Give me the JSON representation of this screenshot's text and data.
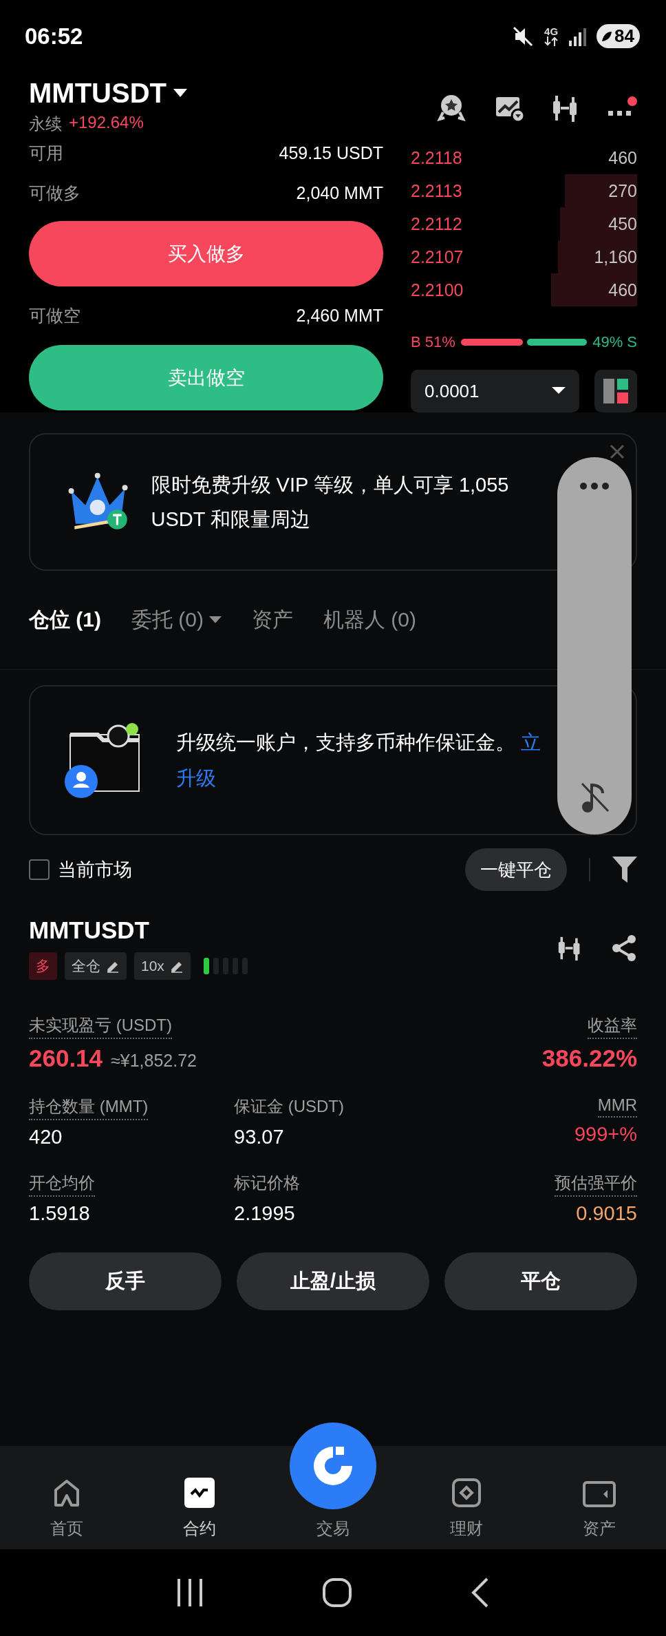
{
  "status_bar": {
    "time": "06:52",
    "network": "4G",
    "battery": "84"
  },
  "header": {
    "symbol": "MMTUSDT",
    "type": "永续",
    "change": "+192.64%",
    "notification": true
  },
  "order_panel": {
    "available_label": "可用",
    "available_value": "459.15 USDT",
    "long_label": "可做多",
    "long_value": "2,040 MMT",
    "buy_button": "买入做多",
    "short_label": "可做空",
    "short_value": "2,460 MMT",
    "sell_button": "卖出做空"
  },
  "order_book": {
    "asks": [
      {
        "price": "2.2118",
        "amount": "460"
      },
      {
        "price": "2.2113",
        "amount": "270"
      },
      {
        "price": "2.2112",
        "amount": "450"
      },
      {
        "price": "2.2107",
        "amount": "1,160"
      },
      {
        "price": "2.2100",
        "amount": "460"
      }
    ],
    "buy_label": "B 51%",
    "sell_label": "49% S",
    "precision": "0.0001"
  },
  "promo_banner": {
    "text": "限时免费升级 VIP 等级，单人可享 1,055 USDT 和限量周边"
  },
  "tabs": [
    {
      "label": "仓位 (1)",
      "selected": true,
      "dropdown": false
    },
    {
      "label": "委托 (0)",
      "selected": false,
      "dropdown": true
    },
    {
      "label": "资产",
      "selected": false,
      "dropdown": false
    },
    {
      "label": "机器人 (0)",
      "selected": false,
      "dropdown": false
    }
  ],
  "account_notice": {
    "text": "升级统一账户，支持多币种作保证金。",
    "link_line_1": "立",
    "link_line_2": "升级"
  },
  "filter": {
    "current_market": {
      "label": "当前市场",
      "checked": false
    },
    "close_all": "一键平仓"
  },
  "position": {
    "symbol": "MMTUSDT",
    "tags": [
      {
        "kind": "side",
        "label": "多"
      },
      {
        "kind": "editable",
        "label": "全仓"
      },
      {
        "kind": "editable",
        "label": "10x"
      }
    ],
    "risk": {
      "level": 0.2
    },
    "stats": [
      {
        "left": {
          "label": "未实现盈亏 (USDT)",
          "value": "260.14",
          "secondary": "≈¥1,852.72",
          "dotted": true,
          "color": "#f6475d"
        },
        "right": {
          "label": "收益率",
          "value": "386.22%",
          "dotted": true,
          "color": "#f6475d"
        }
      },
      {
        "left": {
          "label": "持仓数量 (MMT)",
          "value": "420",
          "dotted": true,
          "color": "#ffffff"
        },
        "middle": {
          "label": "保证金 (USDT)",
          "value": "93.07",
          "dotted": false,
          "color": "#ffffff"
        },
        "right": {
          "label": "MMR",
          "value": "999+%",
          "dotted": true,
          "color": "#f6475d"
        }
      },
      {
        "left": {
          "label": "开仓均价",
          "value": "1.5918",
          "dotted": true,
          "color": "#ffffff"
        },
        "middle": {
          "label": "标记价格",
          "value": "2.1995",
          "dotted": false,
          "color": "#ffffff"
        },
        "right": {
          "label": "预估强平价",
          "value": "0.9015",
          "dotted": true,
          "color": "#f5a56b"
        }
      }
    ],
    "actions": [
      "反手",
      "止盈/止损",
      "平仓"
    ]
  },
  "bottom_nav": [
    {
      "kind": "home",
      "label": "首页",
      "selected": false
    },
    {
      "kind": "futures",
      "label": "合约",
      "selected": true
    },
    {
      "kind": "center",
      "label": "交易",
      "selected": false
    },
    {
      "kind": "earn",
      "label": "理财",
      "selected": false
    },
    {
      "kind": "assets",
      "label": "资产",
      "selected": false
    }
  ]
}
